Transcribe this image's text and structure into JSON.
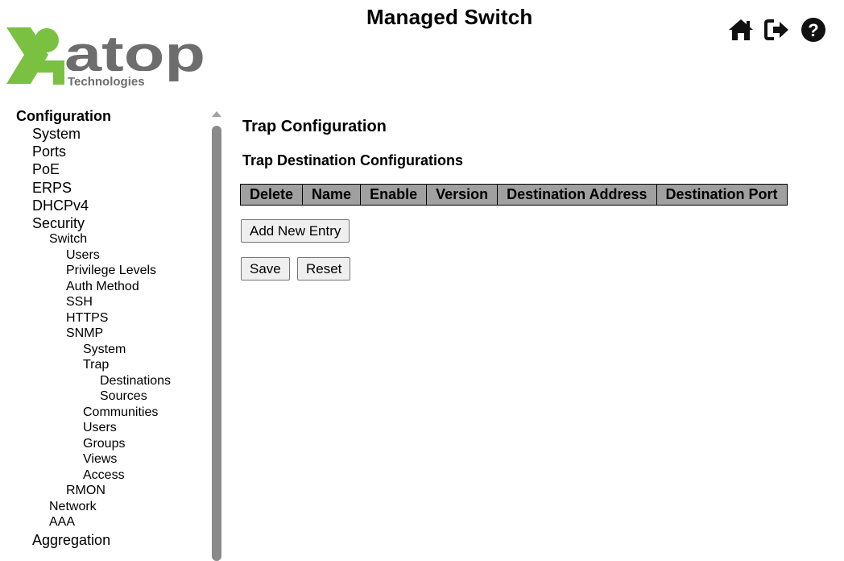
{
  "header": {
    "title": "Managed Switch",
    "logo": {
      "wordmark": "atop",
      "tagline": "Technologies",
      "brand_green": "#7ac142",
      "brand_gray": "#6d6d6d"
    },
    "icons": [
      "home-icon",
      "logout-icon",
      "help-icon"
    ]
  },
  "sidebar": {
    "items": [
      {
        "label": "Configuration",
        "level": 0
      },
      {
        "label": "System",
        "level": 1
      },
      {
        "label": "Ports",
        "level": 1
      },
      {
        "label": "PoE",
        "level": 1
      },
      {
        "label": "ERPS",
        "level": 1
      },
      {
        "label": "DHCPv4",
        "level": 1
      },
      {
        "label": "Security",
        "level": 1
      },
      {
        "label": "Switch",
        "level": 2
      },
      {
        "label": "Users",
        "level": 3
      },
      {
        "label": "Privilege Levels",
        "level": 3
      },
      {
        "label": "Auth Method",
        "level": 3
      },
      {
        "label": "SSH",
        "level": 3
      },
      {
        "label": "HTTPS",
        "level": 3
      },
      {
        "label": "SNMP",
        "level": 3
      },
      {
        "label": "System",
        "level": 4
      },
      {
        "label": "Trap",
        "level": 4
      },
      {
        "label": "Destinations",
        "level": 5
      },
      {
        "label": "Sources",
        "level": 5
      },
      {
        "label": "Communities",
        "level": 4
      },
      {
        "label": "Users",
        "level": 4
      },
      {
        "label": "Groups",
        "level": 4
      },
      {
        "label": "Views",
        "level": 4
      },
      {
        "label": "Access",
        "level": 4
      },
      {
        "label": "RMON",
        "level": 3
      },
      {
        "label": "Network",
        "level": 2
      },
      {
        "label": "AAA",
        "level": 2
      },
      {
        "label": "Aggregation",
        "level": 1
      }
    ]
  },
  "main": {
    "page_title": "Trap Configuration",
    "section_title": "Trap Destination Configurations",
    "table": {
      "columns": [
        "Delete",
        "Name",
        "Enable",
        "Version",
        "Destination Address",
        "Destination Port"
      ],
      "header_bg": "#a0a0a0"
    },
    "add_button": "Add New Entry",
    "save_button": "Save",
    "reset_button": "Reset"
  }
}
